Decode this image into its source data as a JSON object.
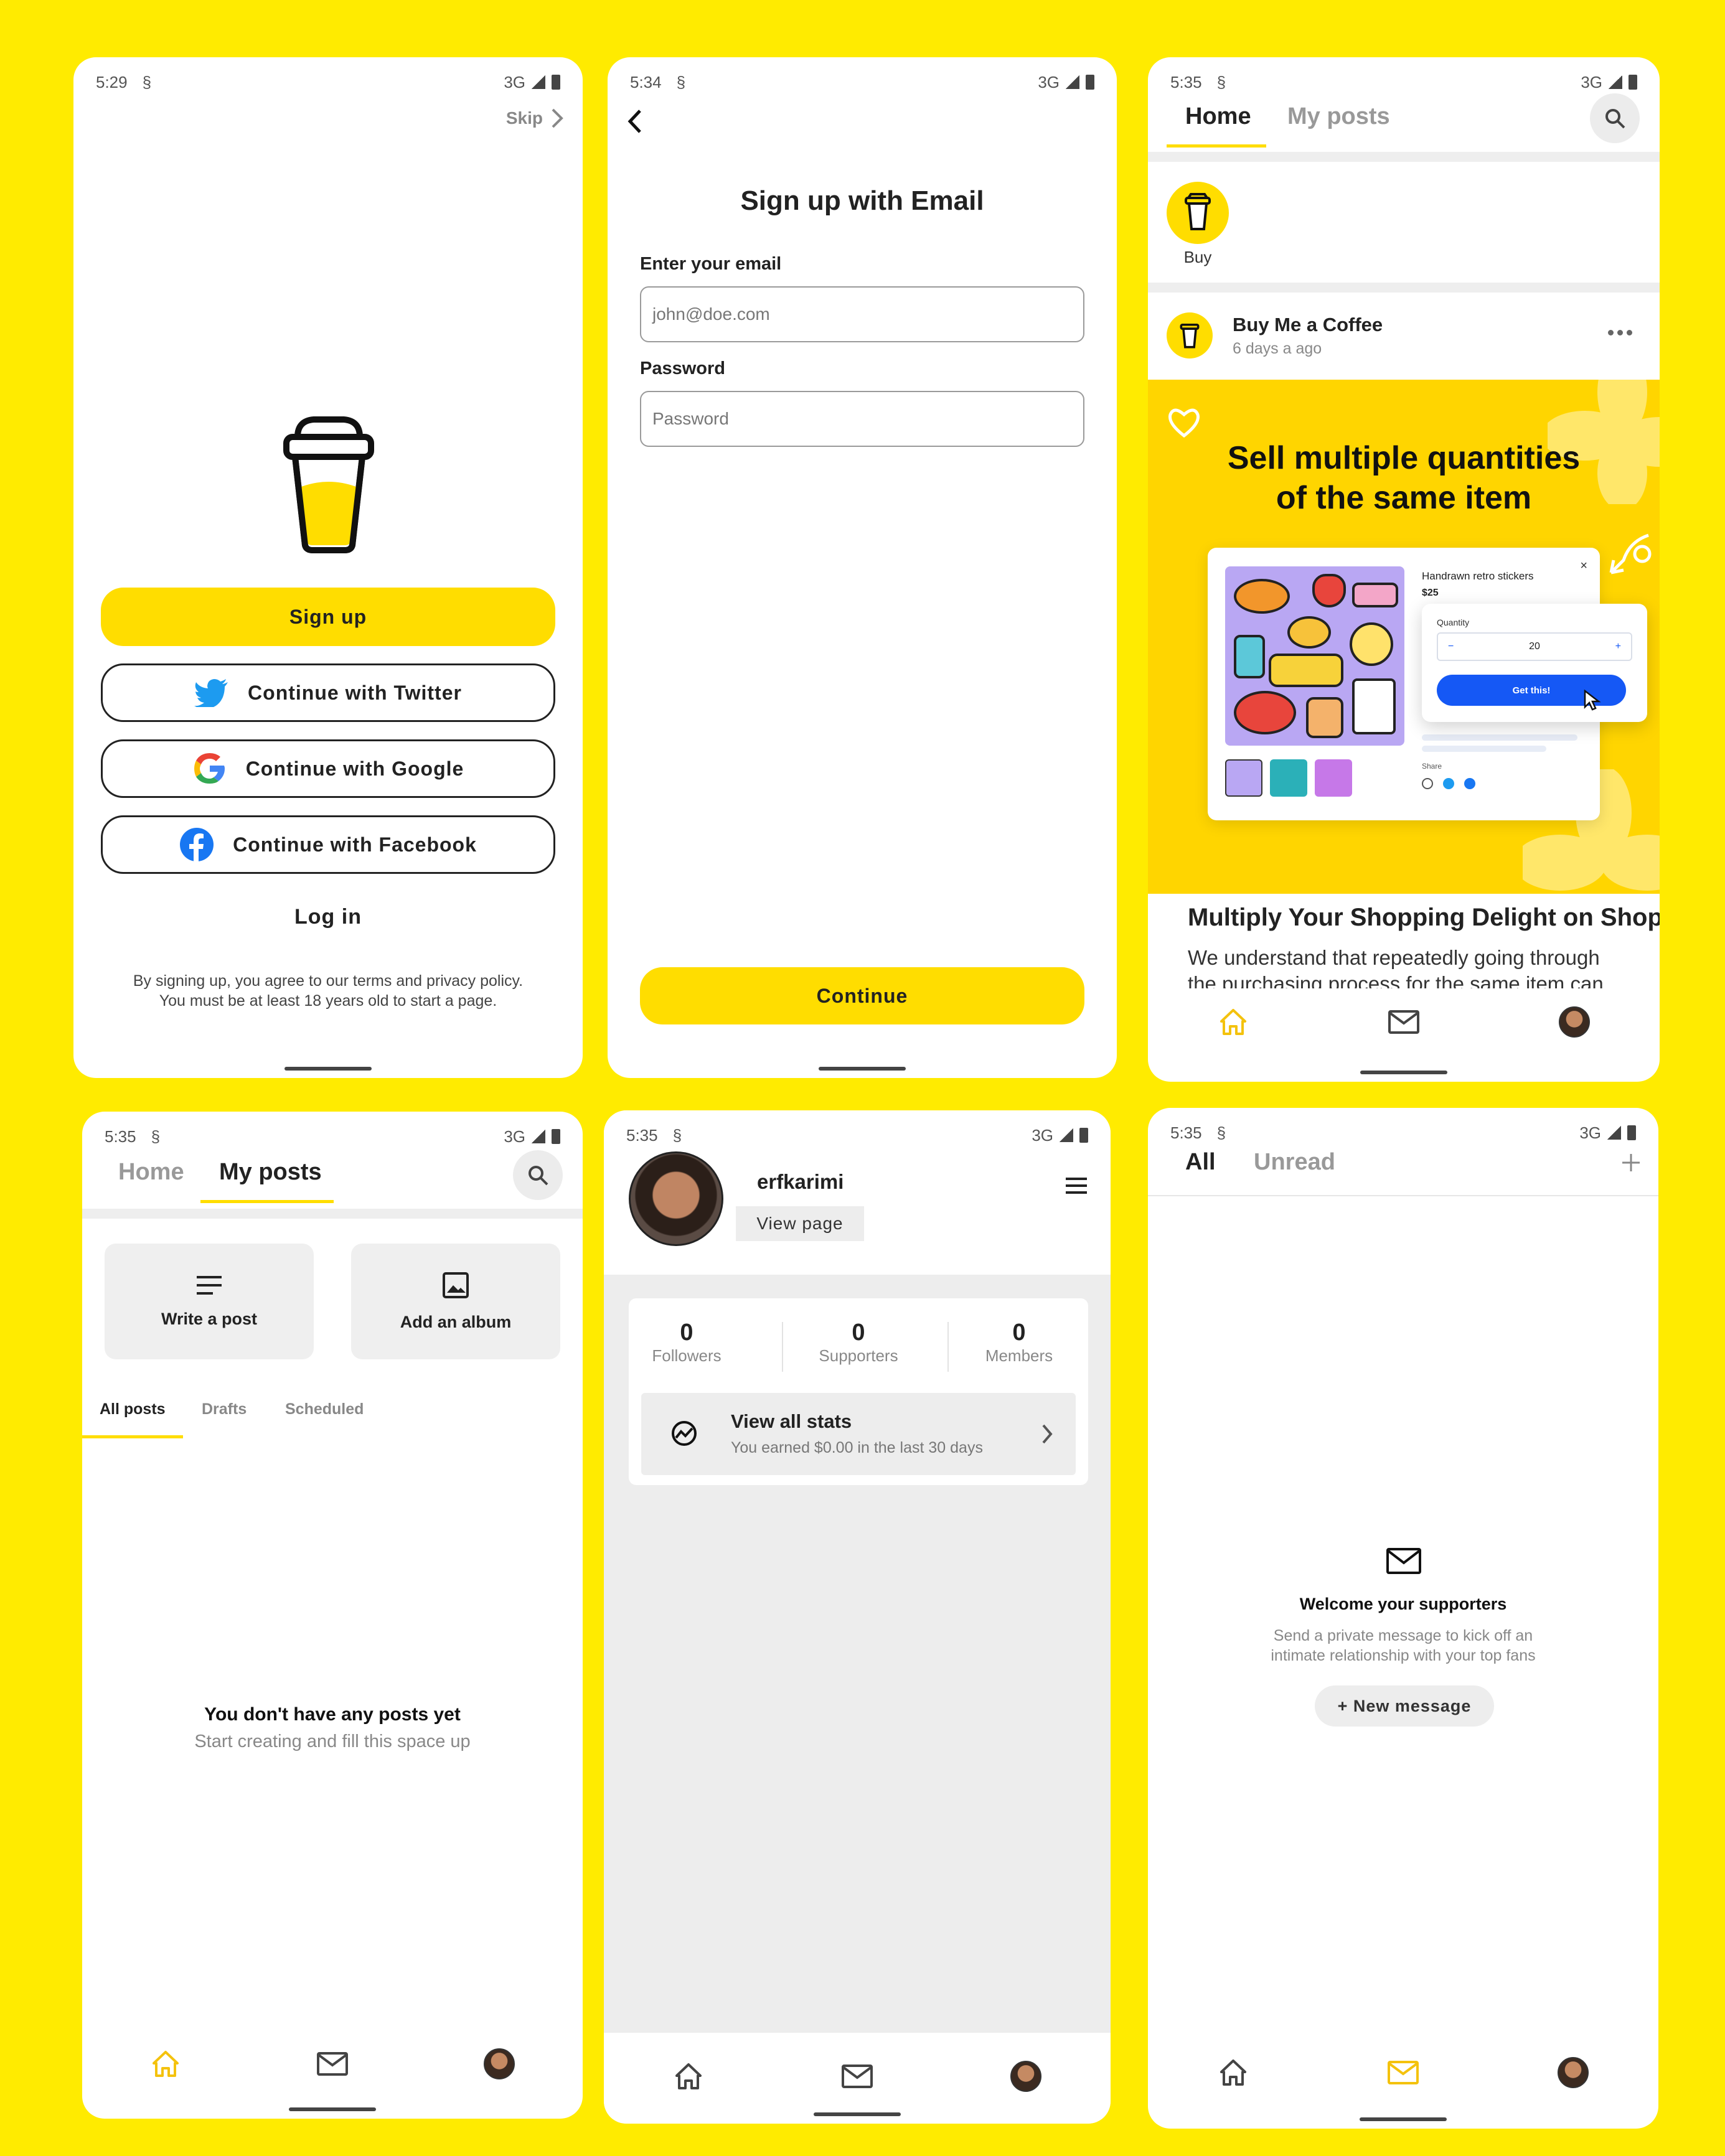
{
  "screen1": {
    "time": "5:29",
    "network": "3G",
    "skip": "Skip",
    "signup": "Sign up",
    "twitter": "Continue with Twitter",
    "google": "Continue with Google",
    "facebook": "Continue with Facebook",
    "login": "Log in",
    "legal1": "By signing up, you agree to our terms and privacy policy.",
    "legal2": "You must be at least 18 years old to start a page."
  },
  "screen2": {
    "time": "5:34",
    "network": "3G",
    "title": "Sign up with Email",
    "email_label": "Enter your email",
    "email_placeholder": "john@doe.com",
    "password_label": "Password",
    "password_placeholder": "Password",
    "continue": "Continue"
  },
  "screen3": {
    "time": "5:35",
    "network": "3G",
    "tab_home": "Home",
    "tab_myposts": "My posts",
    "story_label": "Buy",
    "post_author": "Buy Me a Coffee",
    "post_time": "6 days a ago",
    "banner_line1": "Sell multiple quantities",
    "banner_line2": "of the same item",
    "mock_title": "Handrawn retro stickers",
    "mock_price": "$25",
    "mock_quantity_label": "Quantity",
    "mock_quantity": "20",
    "mock_button": "Get this!",
    "mock_share": "Share",
    "mock_minus": "−",
    "mock_plus": "+",
    "post_title": "Multiply Your Shopping Delight on Shop",
    "post_excerpt1": "We understand that repeatedly going through",
    "post_excerpt2": "the purchasing process for the same item can"
  },
  "screen4": {
    "time": "5:35",
    "network": "3G",
    "tab_home": "Home",
    "tab_myposts": "My posts",
    "write_post": "Write a post",
    "add_album": "Add an album",
    "subtab_all": "All posts",
    "subtab_drafts": "Drafts",
    "subtab_scheduled": "Scheduled",
    "empty_title": "You don't have any posts yet",
    "empty_sub": "Start creating and fill this space up"
  },
  "screen5": {
    "time": "5:35",
    "network": "3G",
    "username": "erfkarimi",
    "view_page": "View page",
    "stats": [
      {
        "value": "0",
        "label": "Followers"
      },
      {
        "value": "0",
        "label": "Supporters"
      },
      {
        "value": "0",
        "label": "Members"
      }
    ],
    "view_stats_title": "View all stats",
    "view_stats_sub": "You earned $0.00 in the last 30 days"
  },
  "screen6": {
    "time": "5:35",
    "network": "3G",
    "tab_all": "All",
    "tab_unread": "Unread",
    "welcome_title": "Welcome your supporters",
    "welcome_sub1": "Send a private message to kick off an",
    "welcome_sub2": "intimate relationship with your top fans",
    "new_message": "+ New message"
  },
  "colors": {
    "background": "#FFEB00",
    "accent": "#FFDD00",
    "active_nav": "#F4C20D",
    "mock_button": "#1558F5"
  }
}
